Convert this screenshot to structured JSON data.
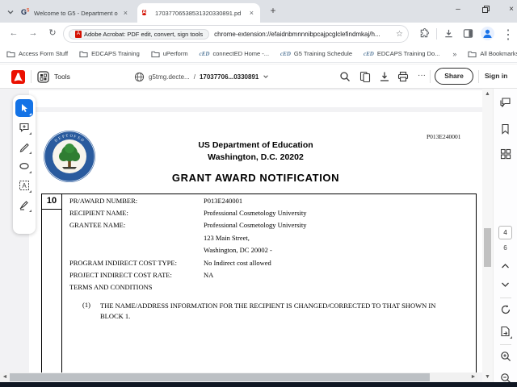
{
  "browser": {
    "tabs": [
      {
        "title": "Welcome to G5 - Department o",
        "favicon": "g5-logo",
        "g5_letter": "G",
        "g5_sup": "5",
        "close": "×"
      },
      {
        "title": "17037706538531320330891.pd",
        "favicon": "pdf-logo",
        "close": "×"
      }
    ],
    "new_tab": "+",
    "address": {
      "chip_label": "Adobe Acrobat: PDF edit, convert, sign tools",
      "url": "chrome-extension://efaidnbmnnnibpcajpcglclefindmkaj/h..."
    },
    "bookmarks": [
      {
        "label": "Access Form Stuff",
        "icon": "folder-icon"
      },
      {
        "label": "EDCAPS Training",
        "icon": "folder-icon"
      },
      {
        "label": "uPerform",
        "icon": "folder-icon"
      },
      {
        "label": "connectED Home -...",
        "icon": "connected-logo"
      },
      {
        "label": "G5 Training Schedule",
        "icon": "connected-logo"
      },
      {
        "label": "EDCAPS Training Do...",
        "icon": "connected-logo"
      }
    ],
    "bookmarks_overflow": "»",
    "all_bookmarks_label": "All Bookmarks",
    "ced_logo_text": "cED"
  },
  "pdf_toolbar": {
    "tools_label": "Tools",
    "breadcrumb_site": "g5tmg.decte...",
    "breadcrumb_separator": "/",
    "breadcrumb_file": "17037706...0330891",
    "more_label": "···",
    "share_label": "Share",
    "sign_in_label": "Sign in"
  },
  "document": {
    "corner_award_number": "P013E240001",
    "agency_line1": "US Department of Education",
    "agency_line2": "Washington, D.C. 20202",
    "title": "GRANT AWARD NOTIFICATION",
    "block_number": "10",
    "fields": [
      {
        "label": "PR/AWARD NUMBER:",
        "value": "P013E240001"
      },
      {
        "label": "RECIPIENT NAME:",
        "value": "Professional Cosmetology University"
      },
      {
        "label": "GRANTEE NAME:",
        "value": "Professional Cosmetology University"
      },
      {
        "label": "",
        "value": "123 Main Street,"
      },
      {
        "label": "",
        "value": "Washington, DC 20002 -"
      },
      {
        "label": "PROGRAM INDIRECT COST TYPE:",
        "value": "No Indirect cost allowed"
      },
      {
        "label": "PROJECT INDIRECT COST RATE:",
        "value": "NA"
      }
    ],
    "terms_heading": "TERMS AND CONDITIONS",
    "term_1_number": "(1)",
    "term_1_text": "THE NAME/ADDRESS INFORMATION FOR THE RECIPIENT IS CHANGED/CORRECTED TO THAT SHOWN IN BLOCK 1."
  },
  "right_panel": {
    "current_page": "4",
    "total_pages": "6"
  },
  "colors": {
    "accent_adobe_red": "#eb1000",
    "accent_select_blue": "#1473e6",
    "chrome_strip": "#dee1e6",
    "seal_ring_blue": "#2a5b9e",
    "seal_tree_green": "#2f7d32"
  }
}
